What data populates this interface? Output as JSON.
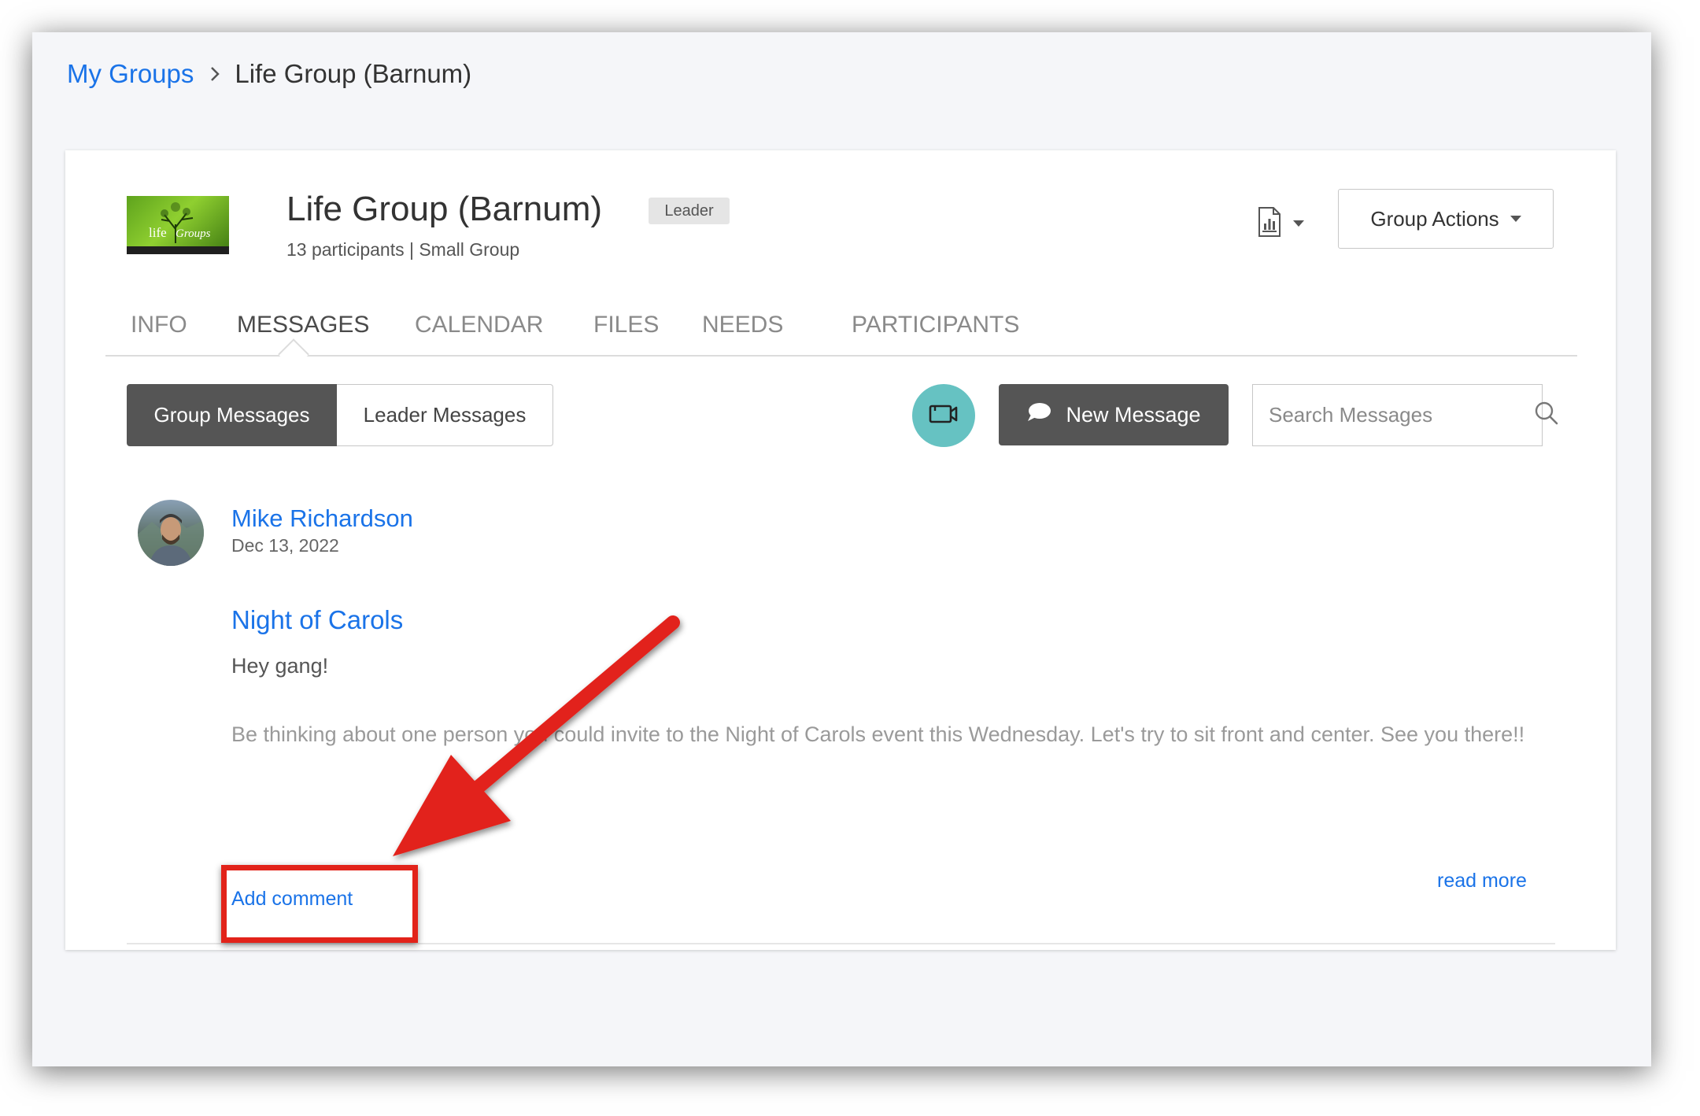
{
  "breadcrumb": {
    "parent": "My Groups",
    "current": "Life Group (Barnum)"
  },
  "group": {
    "title": "Life Group (Barnum)",
    "role_badge": "Leader",
    "subtitle": "13 participants | Small Group",
    "actions_label": "Group Actions",
    "logo_icon": "life-groups-logo"
  },
  "tabs": [
    {
      "label": "INFO",
      "active": false
    },
    {
      "label": "MESSAGES",
      "active": true
    },
    {
      "label": "CALENDAR",
      "active": false
    },
    {
      "label": "FILES",
      "active": false
    },
    {
      "label": "NEEDS",
      "active": false
    },
    {
      "label": "PARTICIPANTS",
      "active": false
    }
  ],
  "toolbar": {
    "group_messages": "Group Messages",
    "leader_messages": "Leader Messages",
    "new_message": "New Message",
    "search_placeholder": "Search Messages"
  },
  "message": {
    "author": "Mike Richardson",
    "date": "Dec 13, 2022",
    "title": "Night of Carols",
    "greeting": "Hey gang!",
    "body": "Be thinking about one person you could invite to the Night of Carols event this Wednesday. Let's try to sit front and center. See you there!!",
    "add_comment": "Add comment",
    "read_more": "read more"
  },
  "colors": {
    "link": "#1a73e8",
    "dark_button": "#555555",
    "video_button": "#66c2c2",
    "annotation": "#e2231a"
  }
}
